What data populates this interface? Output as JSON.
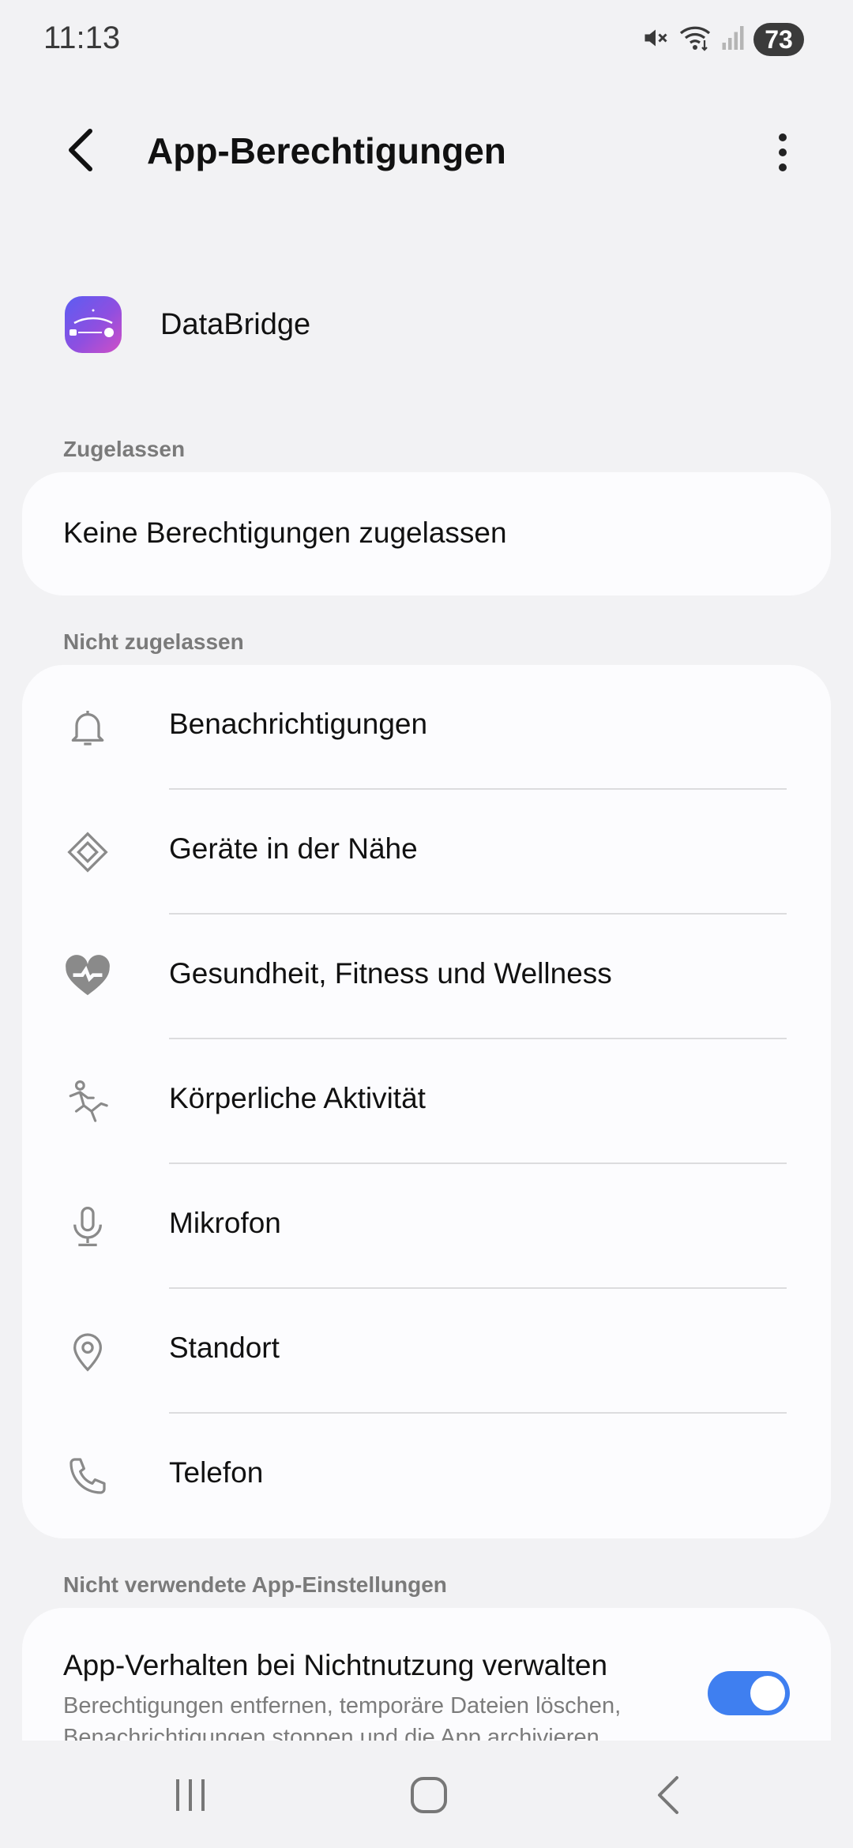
{
  "status_bar": {
    "time": "11:13",
    "battery": "73",
    "icons": [
      "mute-icon",
      "wifi-icon",
      "signal-icon",
      "battery-icon"
    ]
  },
  "header": {
    "title": "App-Berechtigungen",
    "back_icon": "back-arrow-icon",
    "more_icon": "more-vert-icon"
  },
  "app": {
    "name": "DataBridge",
    "icon": "databridge-app-icon"
  },
  "allowed": {
    "label": "Zugelassen",
    "empty_text": "Keine Berechtigungen zugelassen"
  },
  "not_allowed": {
    "label": "Nicht zugelassen",
    "items": [
      {
        "label": "Benachrichtigungen",
        "icon": "bell-icon"
      },
      {
        "label": "Geräte in der Nähe",
        "icon": "nearby-devices-icon"
      },
      {
        "label": "Gesundheit, Fitness und Wellness",
        "icon": "health-heart-icon"
      },
      {
        "label": "Körperliche Aktivität",
        "icon": "running-person-icon"
      },
      {
        "label": "Mikrofon",
        "icon": "microphone-icon"
      },
      {
        "label": "Standort",
        "icon": "location-pin-icon"
      },
      {
        "label": "Telefon",
        "icon": "phone-icon"
      }
    ]
  },
  "unused_settings": {
    "label": "Nicht verwendete App-Einstellungen",
    "title": "App-Verhalten bei Nichtnutzung verwalten",
    "subtitle": "Berechtigungen entfernen, temporäre Dateien löschen, Benachrichtigungen stoppen und die App archivieren",
    "toggle_on": true
  },
  "colors": {
    "background": "#f2f2f4",
    "card": "#fcfcfe",
    "accent": "#3f7ff0",
    "icon_gray": "#8a8a8a"
  },
  "navbar": {
    "icons": [
      "recents-icon",
      "home-icon",
      "back-nav-icon"
    ]
  }
}
